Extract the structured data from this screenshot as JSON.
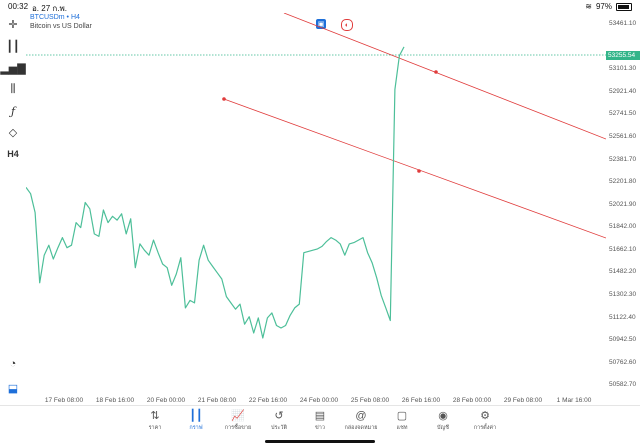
{
  "status": {
    "time": "00:32",
    "date": "อ. 27 ก.พ.",
    "battery": "97%"
  },
  "symbol": {
    "title": "BTCUSDm • H4",
    "subtitle": "Bitcoin vs US Dollar"
  },
  "current_price": "53255.54",
  "price_levels": [
    "53461.10",
    "53101.30",
    "52921.40",
    "52741.50",
    "52561.60",
    "52381.70",
    "52201.80",
    "52021.90",
    "51842.00",
    "51662.10",
    "51482.20",
    "51302.30",
    "51122.40",
    "50942.50",
    "50762.60",
    "50582.70"
  ],
  "time_labels": [
    "17 Feb 08:00",
    "18 Feb 16:00",
    "20 Feb 00:00",
    "21 Feb 08:00",
    "22 Feb 16:00",
    "24 Feb 00:00",
    "25 Feb 08:00",
    "26 Feb 16:00",
    "28 Feb 00:00",
    "29 Feb 08:00",
    "1 Mar 16:00"
  ],
  "toolbar_icons": [
    "crosshair-icon",
    "candles-icon",
    "bar-chart-icon",
    "sliders-icon",
    "function-icon",
    "shapes-icon",
    "timeframe-h4"
  ],
  "timeframe_label": "H4",
  "nav": [
    {
      "label": "ราคา",
      "icon": "quotes-icon"
    },
    {
      "label": "กราฟ",
      "icon": "chart-icon"
    },
    {
      "label": "การซื้อขาย",
      "icon": "trade-icon"
    },
    {
      "label": "ประวัติ",
      "icon": "history-icon"
    },
    {
      "label": "ข่าว",
      "icon": "news-icon"
    },
    {
      "label": "กล่องจดหมาย",
      "icon": "mailbox-icon"
    },
    {
      "label": "แชท",
      "icon": "chat-icon"
    },
    {
      "label": "บัญชี",
      "icon": "account-icon"
    },
    {
      "label": "การตั้งค่า",
      "icon": "settings-icon"
    }
  ],
  "colors": {
    "line": "#4dbf99",
    "channel": "#e03c3c",
    "accent": "#1e6fd9",
    "price_tag": "#33b58a"
  },
  "chart_data": {
    "type": "line",
    "series": [
      {
        "values": [
          52160,
          52110,
          51960,
          51400,
          51620,
          51700,
          51590,
          51680,
          51760,
          51680,
          51700,
          51880,
          51840,
          52040,
          51990,
          51790,
          51770,
          51980,
          51880,
          51930,
          51900,
          51950,
          51790,
          51910,
          51520,
          51710,
          51660,
          51620,
          51740,
          51640,
          51550,
          51520,
          51380,
          51470,
          51600,
          51200,
          51260,
          51240,
          51580,
          51700,
          51580,
          51530,
          51480,
          51430,
          51290,
          51240,
          51190,
          51230,
          51070,
          51130,
          51000,
          51120,
          50960,
          51120,
          51160,
          51060,
          51040,
          51060,
          51140,
          51200,
          51230,
          51640,
          51650,
          51660,
          51670,
          51690,
          51730,
          51760,
          51740,
          51710,
          51620,
          51710,
          51720,
          51740,
          51760,
          51640,
          51560,
          51440,
          51300,
          51200,
          51100,
          52940,
          53210,
          53280
        ]
      }
    ],
    "ylim": [
      50490,
      53550
    ]
  }
}
